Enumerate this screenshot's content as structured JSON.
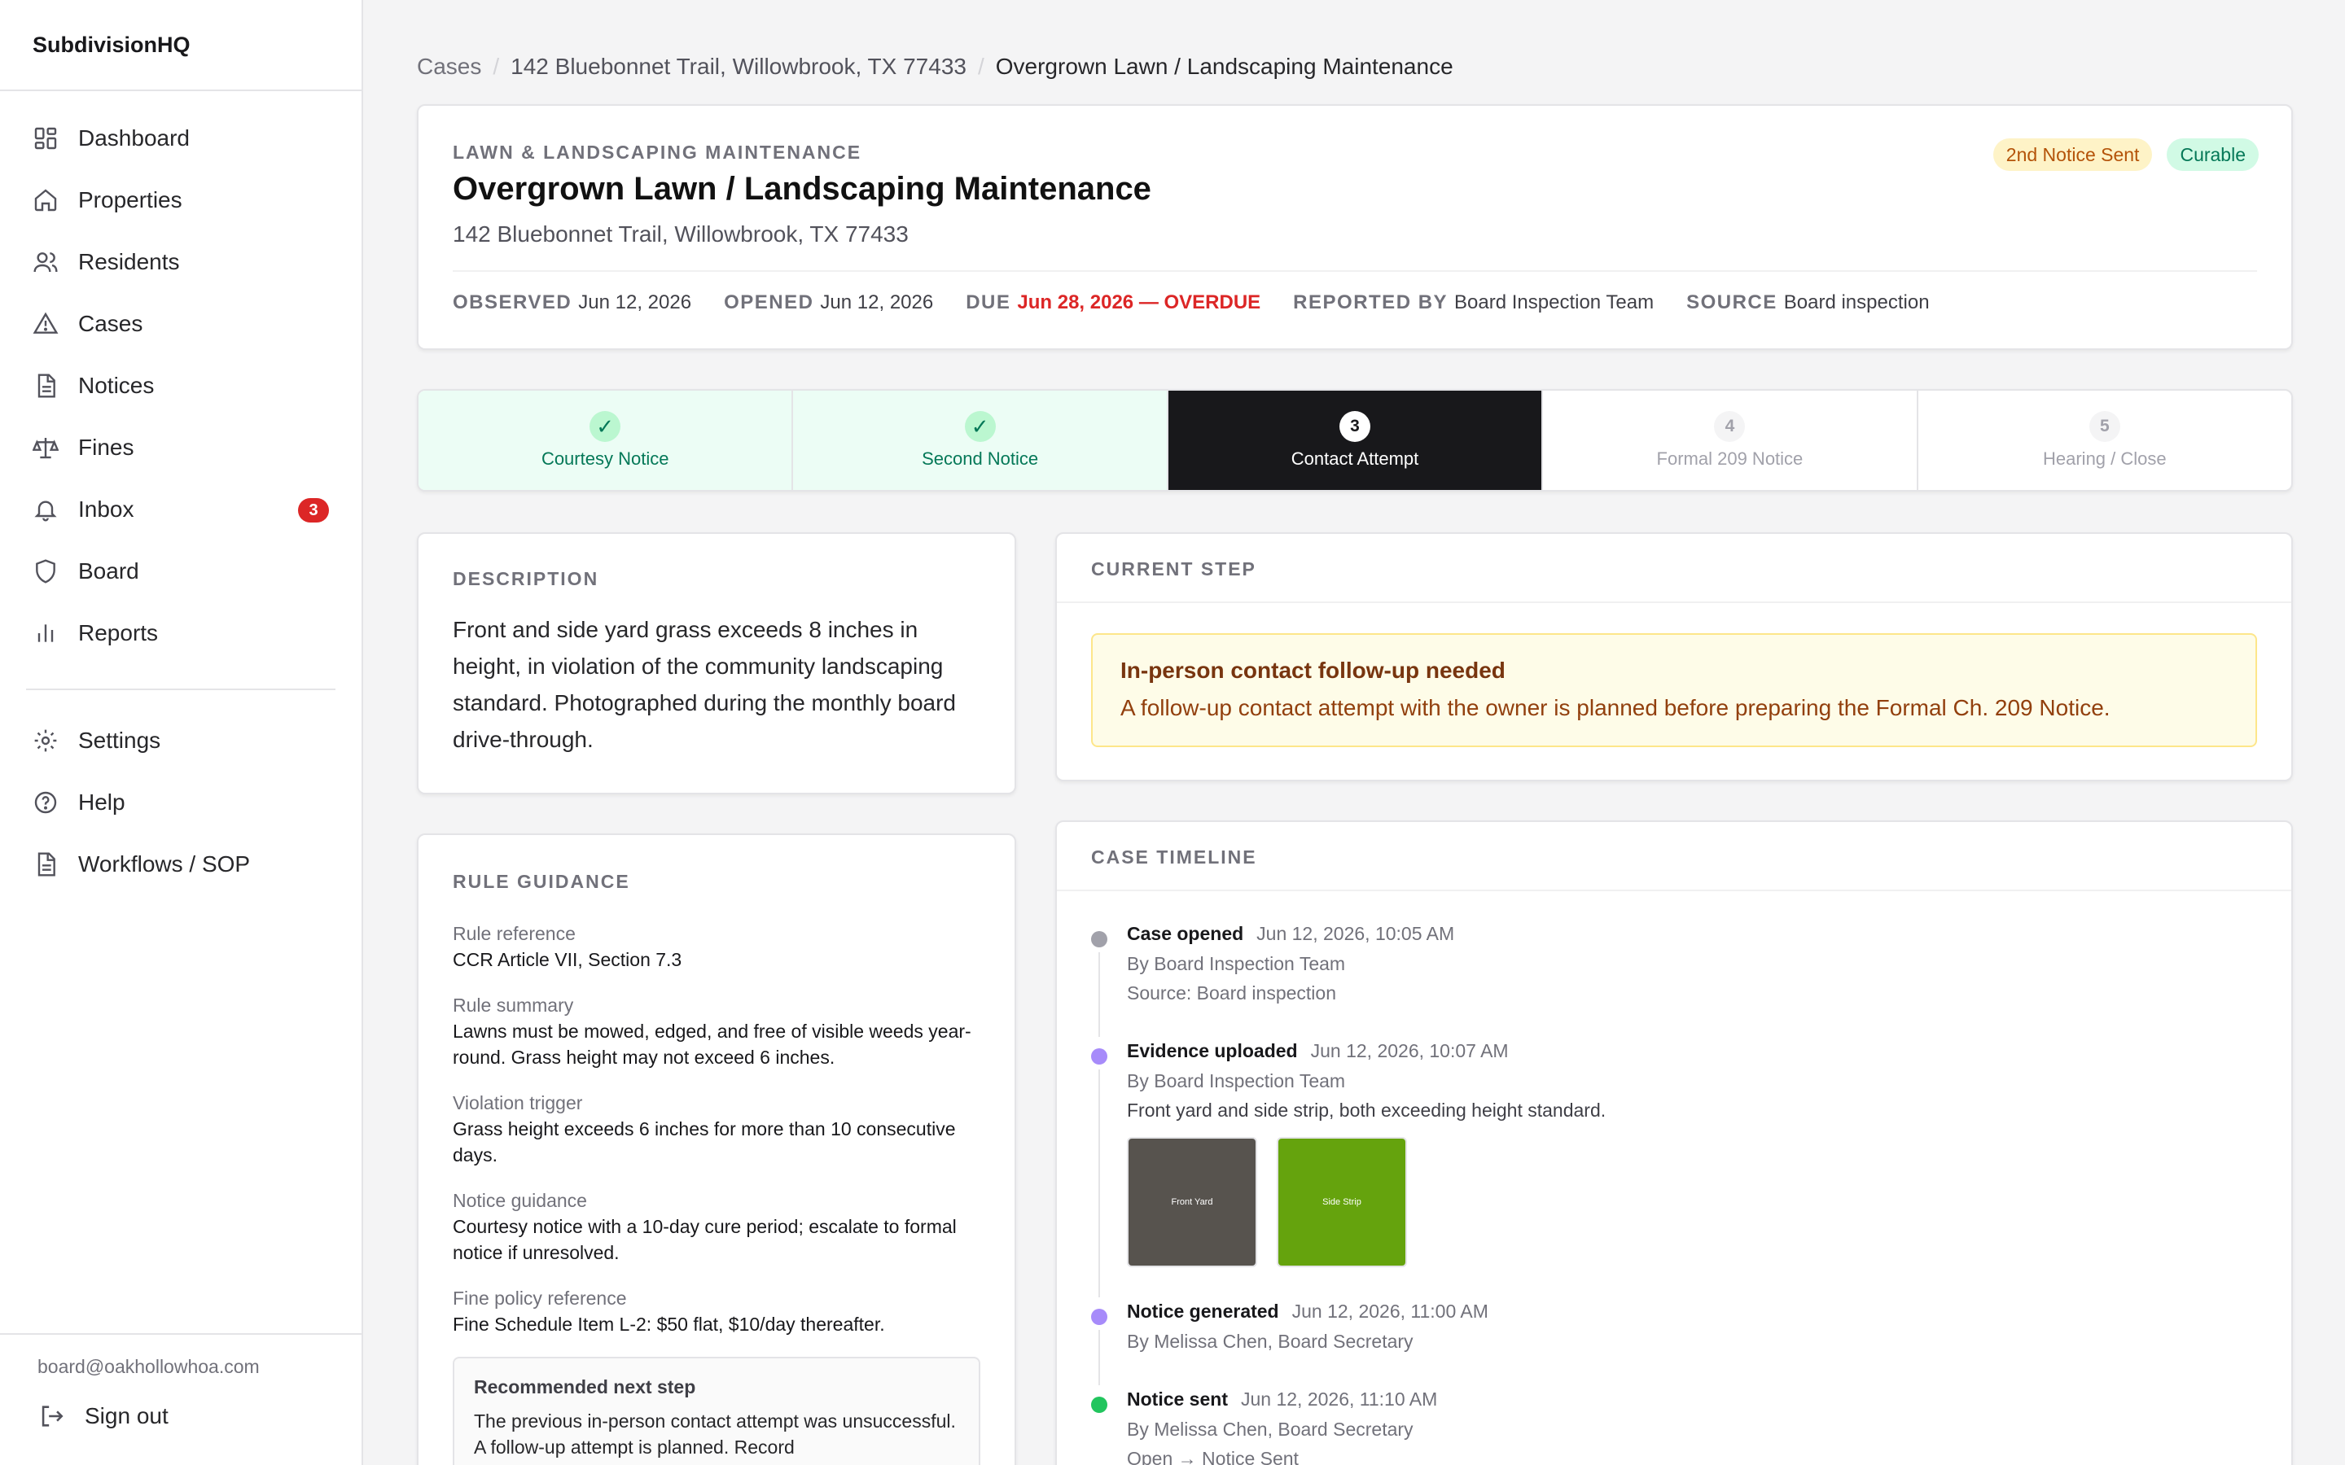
{
  "app": {
    "brand": "SubdivisionHQ"
  },
  "sidebar": {
    "items": [
      {
        "label": "Dashboard",
        "icon": "dashboard-icon"
      },
      {
        "label": "Properties",
        "icon": "home-icon"
      },
      {
        "label": "Residents",
        "icon": "users-icon"
      },
      {
        "label": "Cases",
        "icon": "warning-icon"
      },
      {
        "label": "Notices",
        "icon": "document-icon"
      },
      {
        "label": "Fines",
        "icon": "scale-icon"
      },
      {
        "label": "Inbox",
        "icon": "bell-icon",
        "badge": "3"
      },
      {
        "label": "Board",
        "icon": "shield-icon"
      },
      {
        "label": "Reports",
        "icon": "bar-chart-icon"
      }
    ],
    "secondary": [
      {
        "label": "Settings",
        "icon": "gear-icon"
      },
      {
        "label": "Help",
        "icon": "help-icon"
      },
      {
        "label": "Workflows / SOP",
        "icon": "document-icon"
      }
    ],
    "footer": {
      "email": "board@oakhollowhoa.com",
      "signout": "Sign out"
    }
  },
  "breadcrumb": {
    "root": "Cases",
    "property": "142 Bluebonnet Trail, Willowbrook, TX 77433",
    "current": "Overgrown Lawn / Landscaping Maintenance"
  },
  "case": {
    "category": "LAWN & LANDSCAPING MAINTENANCE",
    "title": "Overgrown Lawn / Landscaping Maintenance",
    "address": "142 Bluebonnet Trail, Willowbrook, TX 77433",
    "badges": {
      "notice": "2nd Notice Sent",
      "cure": "Curable"
    },
    "meta": {
      "observed_k": "OBSERVED",
      "observed_v": "Jun 12, 2026",
      "opened_k": "OPENED",
      "opened_v": "Jun 12, 2026",
      "due_k": "DUE",
      "due_v": "Jun 28, 2026 — OVERDUE",
      "reported_k": "REPORTED BY",
      "reported_v": "Board Inspection Team",
      "source_k": "SOURCE",
      "source_v": "Board inspection"
    }
  },
  "steps": [
    {
      "mark": "✓",
      "label": "Courtesy Notice",
      "state": "done"
    },
    {
      "mark": "✓",
      "label": "Second Notice",
      "state": "done"
    },
    {
      "mark": "3",
      "label": "Contact Attempt",
      "state": "active"
    },
    {
      "mark": "4",
      "label": "Formal 209 Notice",
      "state": "todo"
    },
    {
      "mark": "5",
      "label": "Hearing / Close",
      "state": "todo"
    }
  ],
  "description": {
    "heading": "DESCRIPTION",
    "text": "Front and side yard grass exceeds 8 inches in height, in violation of the community landscaping standard. Photographed during the monthly board drive-through."
  },
  "rules": {
    "heading": "RULE GUIDANCE",
    "items": [
      {
        "k": "Rule reference",
        "v": "CCR Article VII, Section 7.3"
      },
      {
        "k": "Rule summary",
        "v": "Lawns must be mowed, edged, and free of visible weeds year-round. Grass height may not exceed 6 inches."
      },
      {
        "k": "Violation trigger",
        "v": "Grass height exceeds 6 inches for more than 10 consecutive days."
      },
      {
        "k": "Notice guidance",
        "v": "Courtesy notice with a 10-day cure period; escalate to formal notice if unresolved."
      },
      {
        "k": "Fine policy reference",
        "v": "Fine Schedule Item L-2: $50 flat, $10/day thereafter."
      }
    ],
    "recommended": {
      "title": "Recommended next step",
      "text": "The previous in-person contact attempt was unsuccessful. A follow-up attempt is planned. Record"
    }
  },
  "current_step": {
    "heading": "CURRENT STEP",
    "alert_title": "In-person contact follow-up needed",
    "alert_text": "A follow-up contact attempt with the owner is planned before preparing the Formal Ch. 209 Notice."
  },
  "timeline": {
    "heading": "CASE TIMELINE",
    "events": [
      {
        "title": "Case opened",
        "time": "Jun 12, 2026, 10:05 AM",
        "by": "By Board Inspection Team",
        "note": "Source: Board inspection",
        "color": "#a1a1aa"
      },
      {
        "title": "Evidence uploaded",
        "time": "Jun 12, 2026, 10:07 AM",
        "by": "By Board Inspection Team",
        "note": "Front yard and side strip, both exceeding height standard.",
        "color": "#a78bfa",
        "photos": [
          {
            "label": "Front Yard",
            "color": "#57534e"
          },
          {
            "label": "Side Strip",
            "color": "#65a30d"
          }
        ]
      },
      {
        "title": "Notice generated",
        "time": "Jun 12, 2026, 11:00 AM",
        "by": "By Melissa Chen, Board Secretary",
        "note": "",
        "color": "#a78bfa"
      },
      {
        "title": "Notice sent",
        "time": "Jun 12, 2026, 11:10 AM",
        "by": "By Melissa Chen, Board Secretary",
        "note": "Open → Notice Sent",
        "color": "#22c55e"
      }
    ]
  }
}
